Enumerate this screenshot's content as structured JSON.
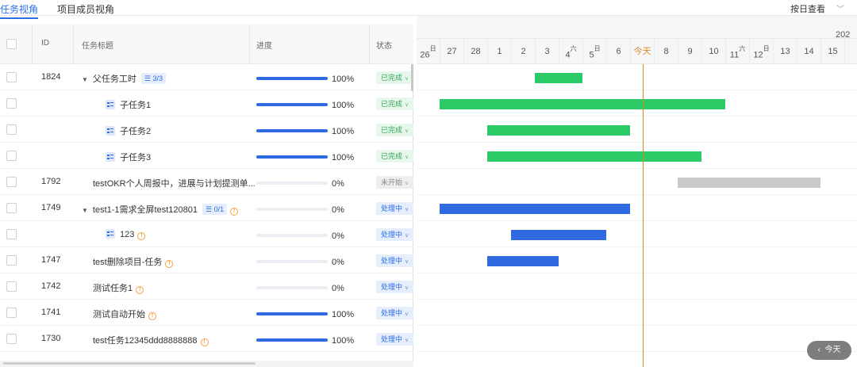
{
  "tabs": [
    "任务视角",
    "项目成员视角"
  ],
  "view_select": "按日查看",
  "columns": {
    "id": "ID",
    "title": "任务标题",
    "progress": "进度",
    "status": "状态"
  },
  "rows": [
    {
      "id": "1824",
      "title": "父任务工时",
      "kind": "parent",
      "sub": "3/3",
      "warn": false,
      "progress": "100%",
      "progress_value": 1.0,
      "status": "已完成",
      "status_kind": "done"
    },
    {
      "id": "",
      "title": "子任务1",
      "kind": "child",
      "warn": false,
      "progress": "100%",
      "progress_value": 1.0,
      "status": "已完成",
      "status_kind": "done"
    },
    {
      "id": "",
      "title": "子任务2",
      "kind": "child",
      "warn": false,
      "progress": "100%",
      "progress_value": 1.0,
      "status": "已完成",
      "status_kind": "done"
    },
    {
      "id": "",
      "title": "子任务3",
      "kind": "child",
      "warn": false,
      "progress": "100%",
      "progress_value": 1.0,
      "status": "已完成",
      "status_kind": "done"
    },
    {
      "id": "1792",
      "title": "testOKR个人周报中，进展与计划提测单...",
      "kind": "plain",
      "warn": false,
      "progress": "0%",
      "progress_value": 0,
      "status": "未开始",
      "status_kind": "todo"
    },
    {
      "id": "1749",
      "title": "test1-1需求全屏test120801",
      "kind": "parent",
      "sub": "0/1",
      "warn": true,
      "progress": "0%",
      "progress_value": 0,
      "status": "处理中",
      "status_kind": "doing"
    },
    {
      "id": "",
      "title": "123",
      "kind": "child",
      "warn": true,
      "progress": "0%",
      "progress_value": 0,
      "status": "处理中",
      "status_kind": "doing"
    },
    {
      "id": "1747",
      "title": "test删除项目-任务",
      "kind": "plain",
      "warn": true,
      "progress": "0%",
      "progress_value": 0,
      "status": "处理中",
      "status_kind": "doing"
    },
    {
      "id": "1742",
      "title": "测试任务1",
      "kind": "plain",
      "warn": true,
      "progress": "0%",
      "progress_value": 0,
      "status": "处理中",
      "status_kind": "doing"
    },
    {
      "id": "1741",
      "title": "测试自动开始",
      "kind": "plain",
      "warn": true,
      "progress": "100%",
      "progress_value": 1.0,
      "status": "处理中",
      "status_kind": "doing"
    },
    {
      "id": "1730",
      "title": "test任务12345ddd8888888",
      "kind": "plain",
      "warn": true,
      "progress": "100%",
      "progress_value": 1.0,
      "status": "处理中",
      "status_kind": "doing"
    }
  ],
  "gantt": {
    "year_label": "202",
    "days": [
      {
        "label": "26",
        "mark": "日"
      },
      {
        "label": "27",
        "mark": ""
      },
      {
        "label": "28",
        "mark": ""
      },
      {
        "label": "1",
        "mark": ""
      },
      {
        "label": "2",
        "mark": ""
      },
      {
        "label": "3",
        "mark": ""
      },
      {
        "label": "4",
        "mark": "六"
      },
      {
        "label": "5",
        "mark": "日"
      },
      {
        "label": "6",
        "mark": ""
      },
      {
        "label": "今天",
        "mark": "",
        "today": true
      },
      {
        "label": "8",
        "mark": ""
      },
      {
        "label": "9",
        "mark": ""
      },
      {
        "label": "10",
        "mark": ""
      },
      {
        "label": "11",
        "mark": "六"
      },
      {
        "label": "12",
        "mark": "日"
      },
      {
        "label": "13",
        "mark": ""
      },
      {
        "label": "14",
        "mark": ""
      },
      {
        "label": "15",
        "mark": ""
      }
    ],
    "bars": [
      {
        "row": 0,
        "start": 5,
        "end": 7,
        "color": "green"
      },
      {
        "row": 1,
        "start": 1,
        "end": 13,
        "color": "green"
      },
      {
        "row": 2,
        "start": 3,
        "end": 9,
        "color": "green"
      },
      {
        "row": 3,
        "start": 3,
        "end": 12,
        "color": "green"
      },
      {
        "row": 4,
        "start": 11,
        "end": 17,
        "color": "gray"
      },
      {
        "row": 5,
        "start": 1,
        "end": 9,
        "color": "blue"
      },
      {
        "row": 6,
        "start": 4,
        "end": 8,
        "color": "blue"
      },
      {
        "row": 7,
        "start": 3,
        "end": 6,
        "color": "blue"
      }
    ],
    "colors": {
      "green": "#2bcb68",
      "gray": "#c9c9cc",
      "blue": "#2f6ae0",
      "today": "#d88a1c"
    }
  },
  "today_button": "今天",
  "today_button_icon": "chevron-left-icon"
}
